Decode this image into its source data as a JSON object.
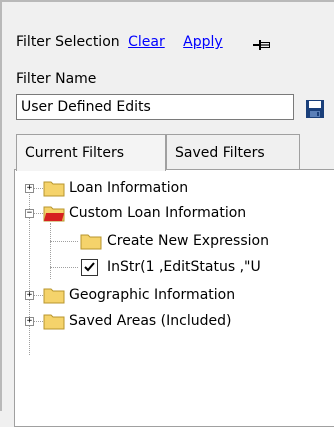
{
  "header": {
    "title": "Filter Selection",
    "clear_link": "Clear",
    "apply_link": "Apply"
  },
  "filter_name": {
    "label": "Filter Name",
    "value": "User Defined Edits"
  },
  "tabs": [
    {
      "label": "Current Filters",
      "active": true
    },
    {
      "label": "Saved Filters",
      "active": false
    }
  ],
  "tree": {
    "items": [
      {
        "label": "Loan Information",
        "expander": "+",
        "icon": "folder-icon"
      },
      {
        "label": "Custom Loan Information",
        "expander": "−",
        "icon": "folder-open-red-icon"
      },
      {
        "label": "Create New Expression",
        "icon": "folder-icon"
      },
      {
        "label": "InStr(1 ,EditStatus ,\"U",
        "icon": "checkbox-checked",
        "checked": true
      },
      {
        "label": "Geographic Information",
        "expander": "+",
        "icon": "folder-icon"
      },
      {
        "label": "Saved Areas (Included)",
        "expander": "+",
        "icon": "folder-icon"
      }
    ]
  },
  "colors": {
    "link": "#0000ff",
    "folder": "#f5d36b",
    "folder_red": "#d62020"
  }
}
